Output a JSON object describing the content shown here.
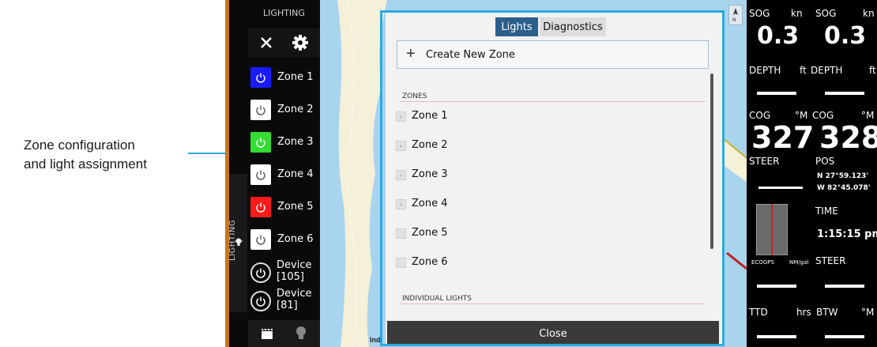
{
  "callout": {
    "line1": "Zone configuration",
    "line2": "and light assignment"
  },
  "sidebar": {
    "header": "LIGHTING",
    "tab_label": "LIGHTING",
    "zones": [
      {
        "label": "Zone 1",
        "color": "#1a1aff"
      },
      {
        "label": "Zone 2",
        "color": "#ffffff"
      },
      {
        "label": "Zone 3",
        "color": "#33dd33"
      },
      {
        "label": "Zone 4",
        "color": "#ffffff"
      },
      {
        "label": "Zone 5",
        "color": "#ff1a1a"
      },
      {
        "label": "Zone 6",
        "color": "#ffffff"
      }
    ],
    "devices": [
      {
        "line1": "Device",
        "line2": "[105]"
      },
      {
        "line1": "Device",
        "line2": "[81]"
      }
    ]
  },
  "dialog": {
    "tabs": {
      "lights": "Lights",
      "diagnostics": "Diagnostics"
    },
    "create_zone": "Create New Zone",
    "zones_header": "ZONES",
    "zones": [
      "Zone 1",
      "Zone 2",
      "Zone 3",
      "Zone 4",
      "Zone 5",
      "Zone 6"
    ],
    "individual_header": "INDIVIDUAL LIGHTS",
    "close": "Close"
  },
  "map": {
    "text": "Ind"
  },
  "instruments": {
    "sog_label": "SOG",
    "sog_unit": "kn",
    "sog1": "0.3",
    "sog2": "0.3",
    "depth_label": "DEPTH",
    "depth_unit": "ft",
    "cog_label": "COG",
    "cog_unit": "°M",
    "cog1": "327",
    "cog2": "328",
    "steer_label": "STEER",
    "pos_label": "POS",
    "pos_lat": "N  27°59.123'",
    "pos_lon": "W  82°45.078'",
    "time_label": "TIME",
    "time_value": "1:15:15 pm",
    "ecogps_label": "ECOGPS",
    "ecogps_unit": "NM/gal",
    "steer2_label": "STEER",
    "ttd_label": "TTD",
    "ttd_unit": "hrs",
    "btw_label": "BTW",
    "btw_unit": "°M"
  },
  "colors": {
    "accent": "#29abe2",
    "tab_active": "#2b5f8c",
    "frame_edge": "#c9761a",
    "map_water": "#a8d4ee"
  }
}
